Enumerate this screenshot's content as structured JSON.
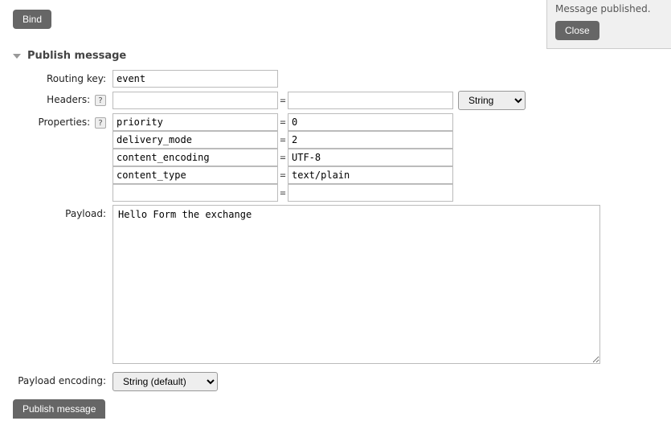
{
  "bind_button": "Bind",
  "notify": {
    "text": "Message published.",
    "close": "Close"
  },
  "section_title": "Publish message",
  "labels": {
    "routing_key": "Routing key:",
    "headers": "Headers:",
    "properties": "Properties:",
    "payload": "Payload:",
    "payload_encoding": "Payload encoding:"
  },
  "help_mark": "?",
  "routing_key_value": "event",
  "headers": {
    "key": "",
    "value": "",
    "type_options": [
      "String"
    ],
    "type_selected": "String"
  },
  "properties": [
    {
      "key": "priority",
      "value": "0"
    },
    {
      "key": "delivery_mode",
      "value": "2"
    },
    {
      "key": "content_encoding",
      "value": "UTF-8"
    },
    {
      "key": "content_type",
      "value": "text/plain"
    },
    {
      "key": "",
      "value": ""
    }
  ],
  "payload": "Hello Form the exchange",
  "payload_encoding_options": [
    "String (default)"
  ],
  "payload_encoding_selected": "String (default)",
  "publish_button": "Publish message"
}
